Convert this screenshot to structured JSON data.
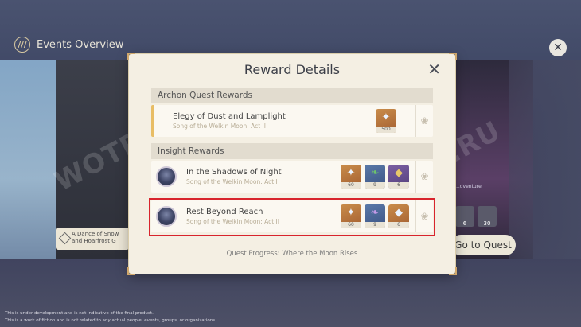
{
  "header": {
    "title": "Events Overview"
  },
  "dialog": {
    "title": "Reward Details",
    "archon_section": "Archon Quest Rewards",
    "insight_section": "Insight Rewards",
    "progress": "Quest Progress: Where the Moon Rises"
  },
  "archon_quest": {
    "title": "Elegy of Dust and Lamplight",
    "subtitle": "Song of the Welkin Moon: Act II",
    "rewards": [
      {
        "icon": "primogem-icon",
        "count": "500"
      }
    ]
  },
  "insight_quests": [
    {
      "title": "In the Shadows of Night",
      "subtitle": "Song of the Welkin Moon: Act I",
      "rewards": [
        {
          "icon": "primogem-icon",
          "count": "60"
        },
        {
          "icon": "exp-book-icon",
          "count": "9"
        },
        {
          "icon": "ore-icon",
          "count": "6"
        }
      ]
    },
    {
      "title": "Rest Beyond Reach",
      "subtitle": "Song of the Welkin Moon: Act II",
      "rewards": [
        {
          "icon": "primogem-icon",
          "count": "60"
        },
        {
          "icon": "exp-book-icon",
          "count": "9"
        },
        {
          "icon": "ore-icon",
          "count": "6"
        }
      ]
    }
  ],
  "background": {
    "left_tab": "A Dance of Snow and Hoarfrost G",
    "go_quest": "Go to Quest",
    "right_slots": [
      "6",
      "30"
    ],
    "right_text": "...dventure",
    "watermark_left": "WOTPACK",
    "watermark_right": "K.RU"
  },
  "footer": {
    "line1": "This is under development and is not indicative of the final product.",
    "line2": "This is a work of fiction and is not related to any actual people, events, groups, or organizations."
  },
  "colors": {
    "highlight": "#d8242d",
    "accent_gold": "#e8bd65",
    "dialog_bg": "#f4efe3"
  }
}
